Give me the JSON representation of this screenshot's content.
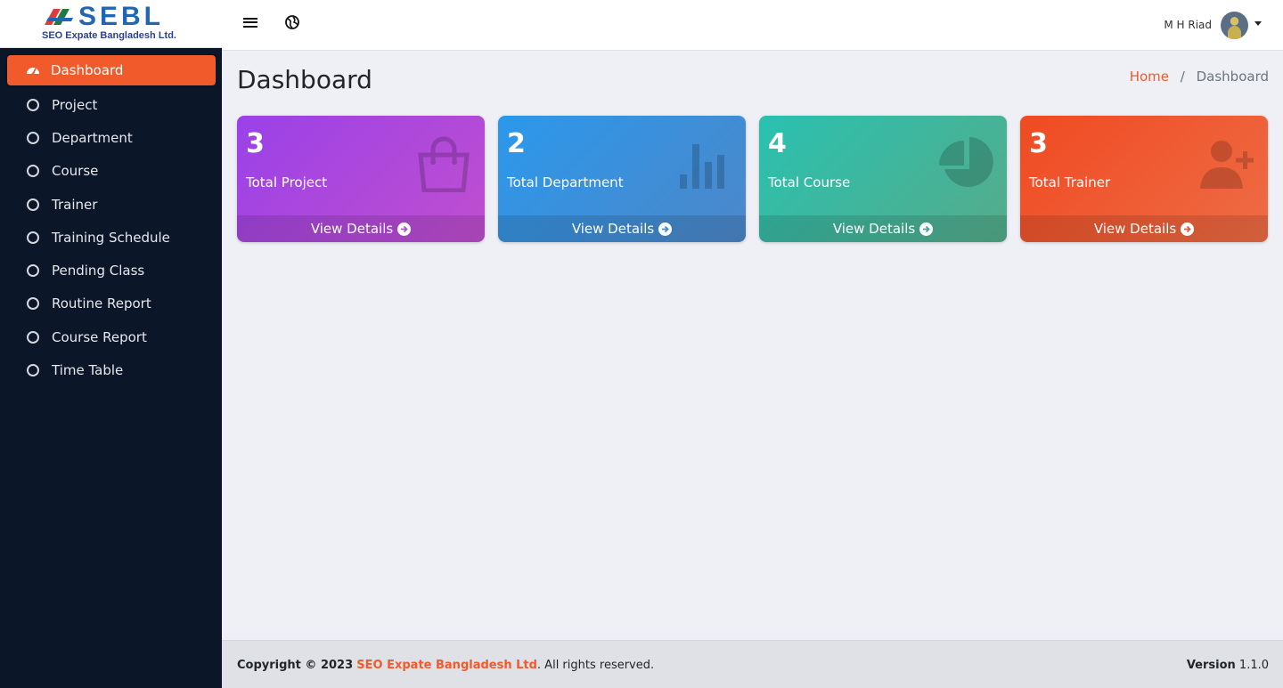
{
  "brand": {
    "logo_text": "SEBL",
    "company_name": "SEO Expate Bangladesh Ltd."
  },
  "topbar": {
    "menu_icon": "hamburger-icon",
    "globe_icon": "globe-icon",
    "user_name": "M H Riad"
  },
  "sidebar": {
    "items": [
      {
        "label": "Dashboard",
        "icon": "speedometer-icon",
        "active": true
      },
      {
        "label": "Project",
        "icon": "circle-icon"
      },
      {
        "label": "Department",
        "icon": "circle-icon"
      },
      {
        "label": "Course",
        "icon": "circle-icon"
      },
      {
        "label": "Trainer",
        "icon": "circle-icon"
      },
      {
        "label": "Training Schedule",
        "icon": "circle-icon"
      },
      {
        "label": "Pending Class",
        "icon": "circle-icon"
      },
      {
        "label": "Routine Report",
        "icon": "circle-icon"
      },
      {
        "label": "Course Report",
        "icon": "circle-icon"
      },
      {
        "label": "Time Table",
        "icon": "circle-icon"
      }
    ]
  },
  "main": {
    "title": "Dashboard",
    "breadcrumb": {
      "home": "Home",
      "separator": "/",
      "current": "Dashboard"
    },
    "cards": [
      {
        "count": "3",
        "label": "Total Project",
        "link": "View Details",
        "icon": "shopping-bag-icon",
        "color": "#9a41e8"
      },
      {
        "count": "2",
        "label": "Total Department",
        "link": "View Details",
        "icon": "bar-chart-icon",
        "color": "#2b98ec"
      },
      {
        "count": "4",
        "label": "Total Course",
        "link": "View Details",
        "icon": "pie-chart-icon",
        "color": "#29c1b0"
      },
      {
        "count": "3",
        "label": "Total Trainer",
        "link": "View Details",
        "icon": "user-plus-icon",
        "color": "#f04a22"
      }
    ]
  },
  "footer": {
    "copyright": "Copyright © 2023",
    "company": "SEO Expate Bangladesh Ltd",
    "rights": ". All rights reserved.",
    "version_label": "Version",
    "version_value": "1.1.0"
  },
  "colors": {
    "accent": "#f15a2b",
    "sidebar_bg": "#0b1629",
    "content_bg": "#eff0f5"
  }
}
